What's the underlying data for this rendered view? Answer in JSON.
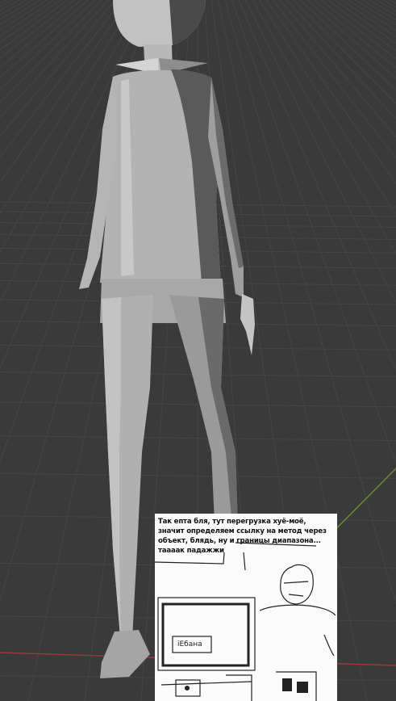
{
  "viewport": {
    "background_color": "#3a3a3a",
    "grid_color": "#444444",
    "x_axis_color": "#9a3a3a",
    "y_axis_color": "#6f8f2f",
    "model_color": "#a9a9a9"
  },
  "comic": {
    "caption": "Так епта бля, тут перегрузка хуё-моё,\nзначит определяем ссылку на метод через\nобъект, блядь, ну и границы диапазона...\nтаааак падажжи",
    "screen_label": "іЕбана"
  }
}
